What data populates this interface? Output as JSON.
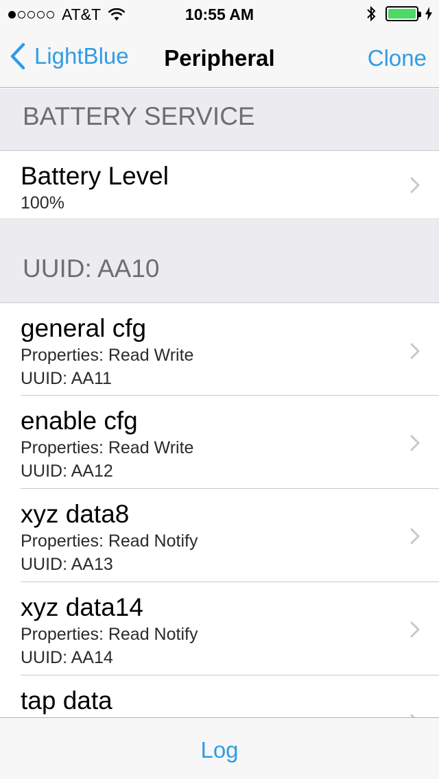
{
  "status_bar": {
    "carrier": "AT&T",
    "signal_bars_filled": 1,
    "signal_bars_total": 5,
    "time": "10:55 AM",
    "battery_level": 1.0,
    "battery_color": "#4cd964"
  },
  "nav": {
    "back_label": "LightBlue",
    "title": "Peripheral",
    "right_label": "Clone"
  },
  "sections": {
    "battery_header": "BATTERY SERVICE",
    "uuid_header": "UUID: AA10"
  },
  "battery_row": {
    "title": "Battery Level",
    "value": "100%"
  },
  "characteristics": [
    {
      "title": "general cfg",
      "properties": "Properties: Read Write",
      "uuid": "UUID: AA11"
    },
    {
      "title": "enable cfg",
      "properties": "Properties: Read Write",
      "uuid": "UUID: AA12"
    },
    {
      "title": "xyz data8",
      "properties": "Properties: Read Notify",
      "uuid": "UUID: AA13"
    },
    {
      "title": "xyz data14",
      "properties": "Properties: Read Notify",
      "uuid": "UUID: AA14"
    },
    {
      "title": "tap data"
    }
  ],
  "toolbar": {
    "log_label": "Log"
  },
  "colors": {
    "accent": "#2f9ce6",
    "section_bg": "#ebebf0",
    "section_text": "#6d6d72"
  }
}
